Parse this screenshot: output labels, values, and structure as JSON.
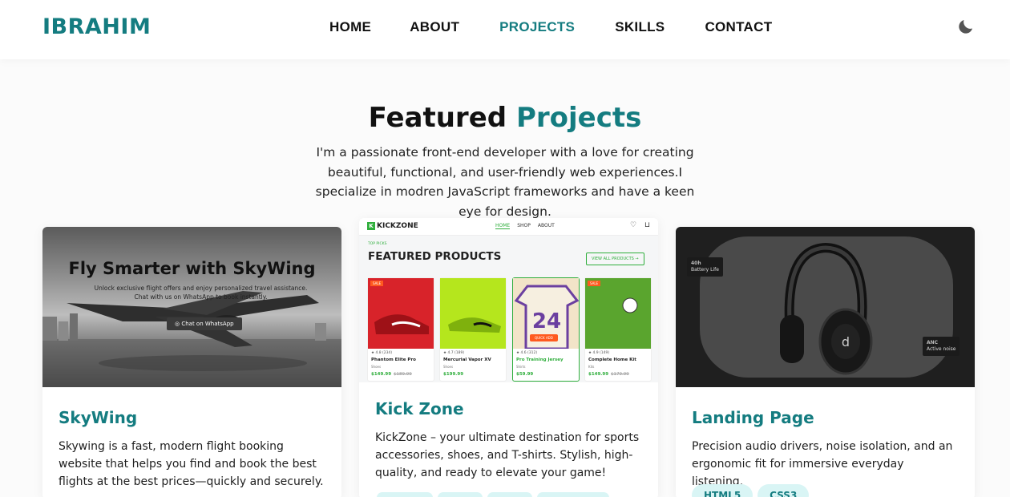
{
  "nav": {
    "brand": "IBRAHIM",
    "items": [
      {
        "label": "HOME",
        "active": false
      },
      {
        "label": "ABOUT",
        "active": false
      },
      {
        "label": "PROJECTS",
        "active": true
      },
      {
        "label": "SKILLS",
        "active": false
      },
      {
        "label": "CONTACT",
        "active": false
      }
    ],
    "theme_toggle_icon": "moon-icon"
  },
  "hero": {
    "title_main": "Featured",
    "title_accent": "Projects",
    "description": "I'm a passionate front-end developer with a love for creating beautiful, functional, and user-friendly web experiences.I specialize in modren JavaScript frameworks and have a keen eye for design."
  },
  "projects": [
    {
      "title": "SkyWing",
      "description": "Skywing is a fast, modern flight booking website that helps you find and book the best flights at the best prices—quickly and securely.",
      "screenshot": {
        "heading": "Fly Smarter with SkyWing",
        "subtext": "Unlock exclusive flight offers and enjoy personalized travel assistance. Chat with us on WhatsApp to book instantly.",
        "button": "Chat on WhatsApp"
      },
      "tags": []
    },
    {
      "title": "Kick Zone",
      "description": "KickZone – your ultimate destination for sports accessories, shoes, and T-shirts. Stylish, high-quality, and ready to elevate your game!",
      "screenshot": {
        "logo": "KICKZONE",
        "nav": [
          "HOME",
          "SHOP",
          "ABOUT"
        ],
        "top_picks": "TOP PICKS",
        "heading": "FEATURED PRODUCTS",
        "view_all": "VIEW ALL PRODUCTS →",
        "quick_add": "QUICK ADD",
        "products": [
          {
            "name": "Phantom Elite Pro",
            "category": "Shoes",
            "rating": "★ 4.8 (234)",
            "price": "$149.99",
            "old_price": "$189.99",
            "sale": true,
            "image_color": "#d8232a"
          },
          {
            "name": "Mercurial Vapor XV",
            "category": "Shoes",
            "rating": "★ 4.7 (189)",
            "price": "$199.99",
            "old_price": "",
            "sale": false,
            "image_color": "#b5e61d"
          },
          {
            "name": "Pro Training Jersey",
            "category": "Shirts",
            "rating": "★ 4.6 (312)",
            "price": "$59.99",
            "old_price": "",
            "sale": false,
            "image_color": "#f2e4c8"
          },
          {
            "name": "Complete Home Kit",
            "category": "Kits",
            "rating": "★ 4.9 (149)",
            "price": "$149.99",
            "old_price": "$179.99",
            "sale": true,
            "image_color": "#5aa52e"
          }
        ]
      },
      "tags": [
        "",
        "",
        "",
        ""
      ]
    },
    {
      "title": "Landing Page",
      "description": "Precision audio drivers, noise isolation, and an ergonomic fit for immersive everyday listening.",
      "screenshot": {
        "badge_1_value": "40h",
        "badge_1_label": "Battery Life",
        "badge_2_value": "ANC",
        "badge_2_label": "Active noise"
      },
      "tags": [
        "HTML5",
        "CSS3"
      ]
    }
  ],
  "colors": {
    "accent": "#147c80",
    "kickzone_green": "#2fae3c",
    "sale_orange": "#ff5a1f"
  }
}
